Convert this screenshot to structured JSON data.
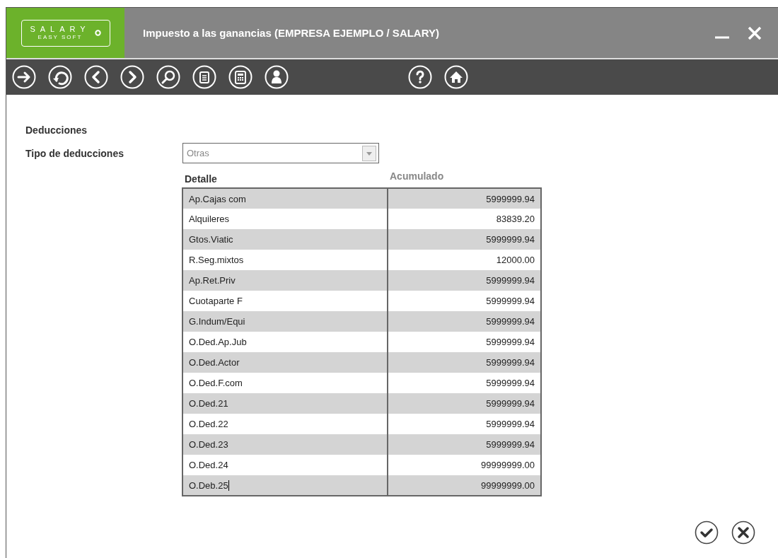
{
  "window": {
    "title": "Impuesto a las ganancias (EMPRESA EJEMPLO / SALARY)"
  },
  "logo": {
    "name": "SALARY",
    "subtitle": "EASY SOFT"
  },
  "section": {
    "title": "Deducciones"
  },
  "deduction_type": {
    "label": "Tipo de deducciones",
    "value": "Otras",
    "disabled": true
  },
  "table": {
    "columns": [
      {
        "label": "Detalle",
        "disabled": false
      },
      {
        "label": "Acumulado",
        "disabled": true
      }
    ],
    "rows": [
      {
        "detalle": "Ap.Cajas com",
        "acumulado": "5999999.94",
        "editing": false
      },
      {
        "detalle": "Alquileres",
        "acumulado": "83839.20",
        "editing": false
      },
      {
        "detalle": "Gtos.Viatic",
        "acumulado": "5999999.94",
        "editing": false
      },
      {
        "detalle": "R.Seg.mixtos",
        "acumulado": "12000.00",
        "editing": false
      },
      {
        "detalle": "Ap.Ret.Priv",
        "acumulado": "5999999.94",
        "editing": false
      },
      {
        "detalle": "Cuotaparte F",
        "acumulado": "5999999.94",
        "editing": false
      },
      {
        "detalle": "G.Indum/Equi",
        "acumulado": "5999999.94",
        "editing": false
      },
      {
        "detalle": "O.Ded.Ap.Jub",
        "acumulado": "5999999.94",
        "editing": false
      },
      {
        "detalle": "O.Ded.Actor",
        "acumulado": "5999999.94",
        "editing": false
      },
      {
        "detalle": "O.Ded.F.com",
        "acumulado": "5999999.94",
        "editing": false
      },
      {
        "detalle": "O.Ded.21",
        "acumulado": "5999999.94",
        "editing": false
      },
      {
        "detalle": "O.Ded.22",
        "acumulado": "5999999.94",
        "editing": false
      },
      {
        "detalle": "O.Ded.23",
        "acumulado": "5999999.94",
        "editing": false
      },
      {
        "detalle": "O.Ded.24",
        "acumulado": "99999999.00",
        "editing": false
      },
      {
        "detalle": "O.Deb.25",
        "acumulado": "99999999.00",
        "editing": true
      }
    ]
  }
}
